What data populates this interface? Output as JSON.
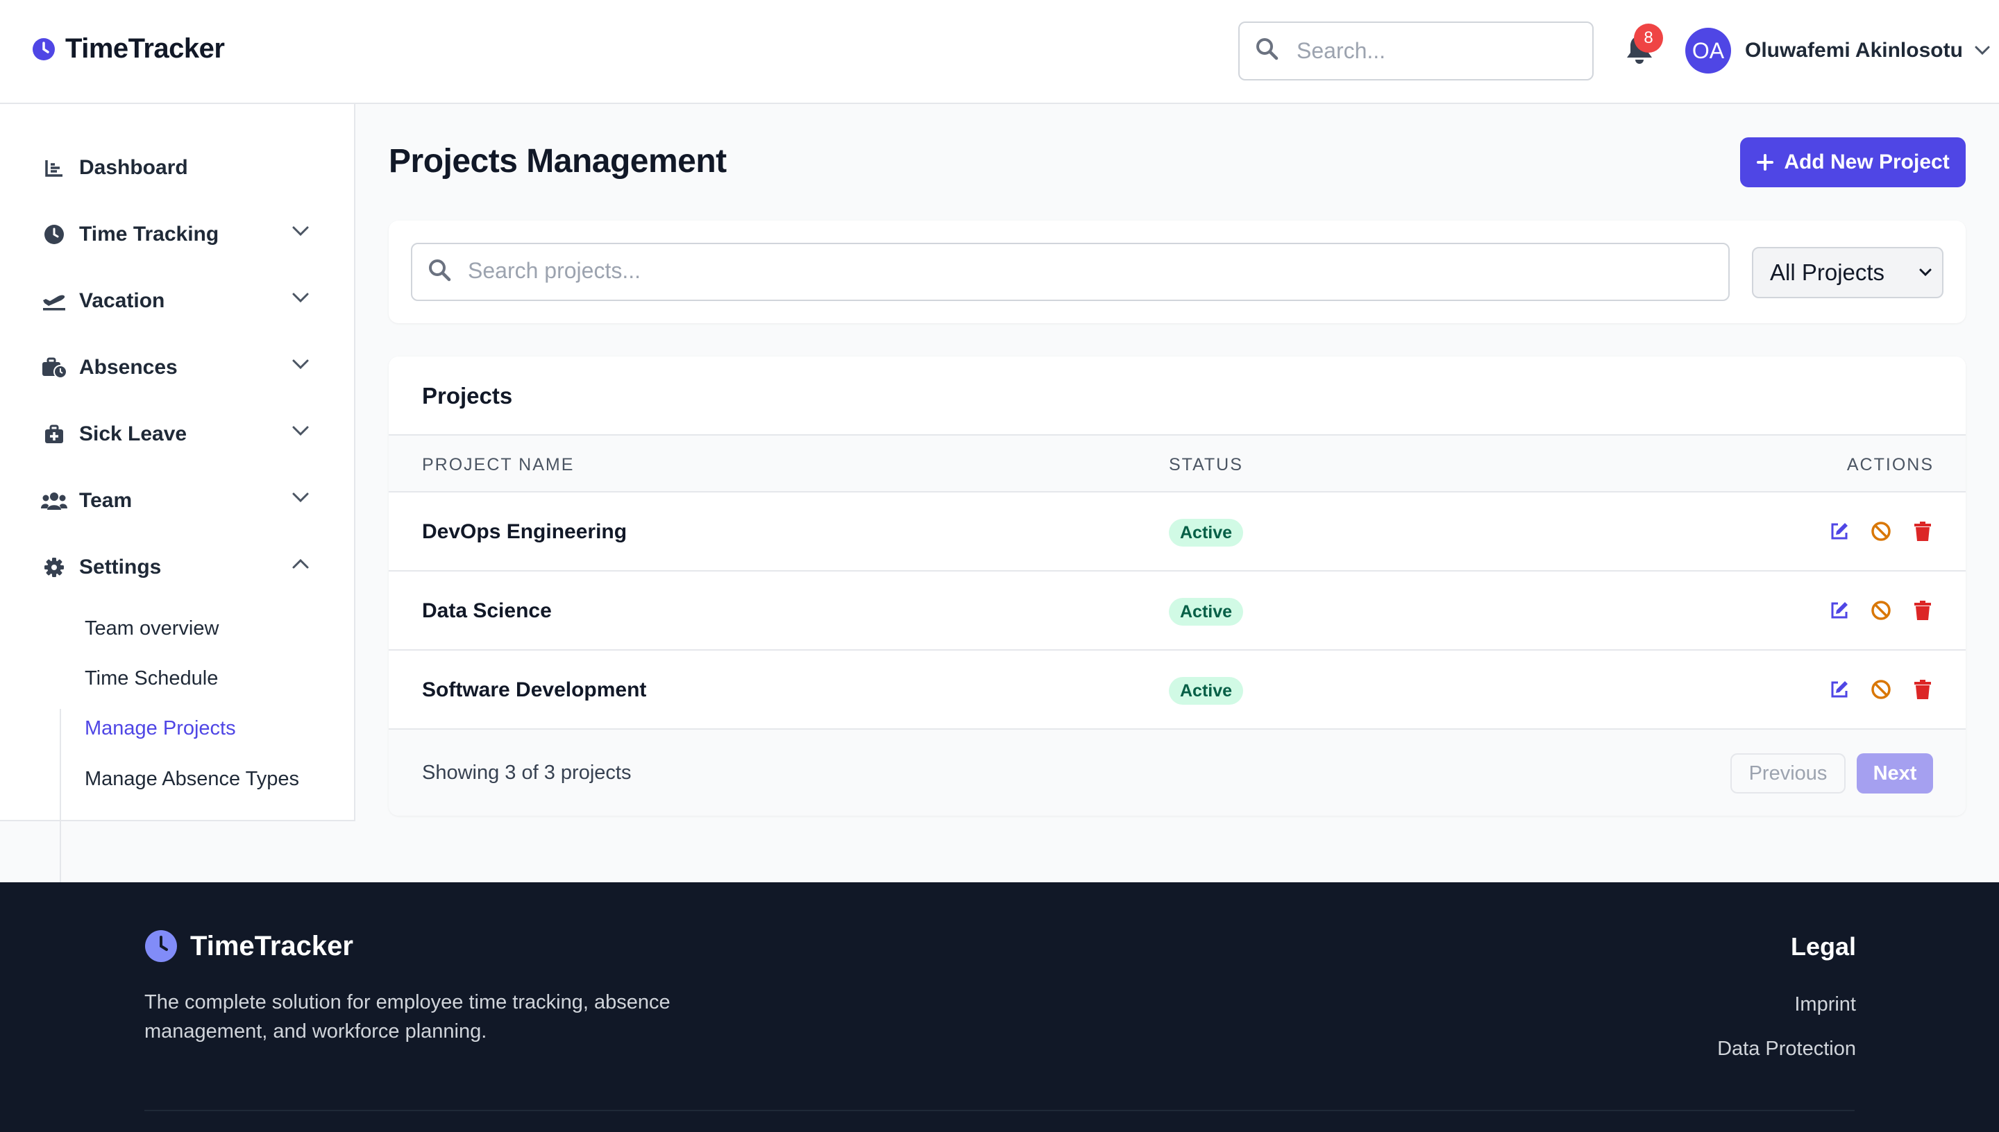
{
  "app": {
    "name": "TimeTracker"
  },
  "topbar": {
    "search_placeholder": "Search...",
    "notification_count": "8",
    "user": {
      "initials": "OA",
      "name": "Oluwafemi Akinlosotu"
    }
  },
  "sidebar": {
    "items": [
      {
        "label": "Dashboard",
        "icon": "chart-icon"
      },
      {
        "label": "Time Tracking",
        "icon": "clock-icon"
      },
      {
        "label": "Vacation",
        "icon": "plane-icon"
      },
      {
        "label": "Absences",
        "icon": "business-time-icon"
      },
      {
        "label": "Sick Leave",
        "icon": "medkit-icon"
      },
      {
        "label": "Team",
        "icon": "users-icon"
      },
      {
        "label": "Settings",
        "icon": "gear-icon"
      }
    ],
    "settings_sub": [
      {
        "label": "Team overview"
      },
      {
        "label": "Time Schedule"
      },
      {
        "label": "Manage Projects",
        "active": true
      },
      {
        "label": "Manage Absence Types"
      }
    ]
  },
  "main": {
    "title": "Projects Management",
    "add_button": "Add New Project",
    "search_placeholder": "Search projects...",
    "filter_selected": "All Projects",
    "table": {
      "title": "Projects",
      "headers": {
        "name": "PROJECT NAME",
        "status": "STATUS",
        "actions": "ACTIONS"
      },
      "rows": [
        {
          "name": "DevOps Engineering",
          "status": "Active"
        },
        {
          "name": "Data Science",
          "status": "Active"
        },
        {
          "name": "Software Development",
          "status": "Active"
        }
      ],
      "footer": {
        "showing": "Showing 3 of 3 projects",
        "previous": "Previous",
        "next": "Next"
      }
    }
  },
  "footer": {
    "brand": "TimeTracker",
    "description": "The complete solution for employee time tracking, absence management, and workforce planning.",
    "legal_heading": "Legal",
    "links": [
      "Imprint",
      "Data Protection"
    ]
  },
  "colors": {
    "primary": "#4f46e5",
    "active_badge_bg": "#d1fae5",
    "active_badge_text": "#065f46",
    "edit": "#4f46e5",
    "deactivate": "#d97706",
    "delete": "#dc2626",
    "footer_bg": "#111827"
  }
}
